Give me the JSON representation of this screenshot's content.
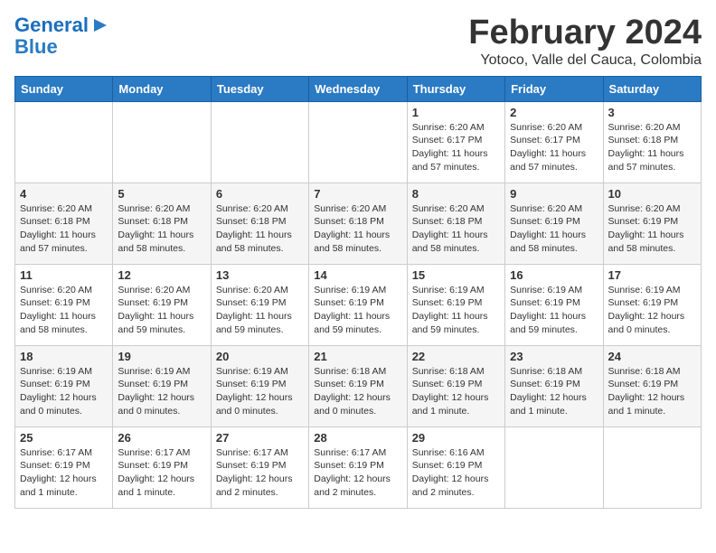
{
  "header": {
    "logo_line1": "General",
    "logo_line2": "Blue",
    "month": "February 2024",
    "location": "Yotoco, Valle del Cauca, Colombia"
  },
  "weekdays": [
    "Sunday",
    "Monday",
    "Tuesday",
    "Wednesday",
    "Thursday",
    "Friday",
    "Saturday"
  ],
  "weeks": [
    [
      {
        "day": "",
        "info": ""
      },
      {
        "day": "",
        "info": ""
      },
      {
        "day": "",
        "info": ""
      },
      {
        "day": "",
        "info": ""
      },
      {
        "day": "1",
        "info": "Sunrise: 6:20 AM\nSunset: 6:17 PM\nDaylight: 11 hours\nand 57 minutes."
      },
      {
        "day": "2",
        "info": "Sunrise: 6:20 AM\nSunset: 6:17 PM\nDaylight: 11 hours\nand 57 minutes."
      },
      {
        "day": "3",
        "info": "Sunrise: 6:20 AM\nSunset: 6:18 PM\nDaylight: 11 hours\nand 57 minutes."
      }
    ],
    [
      {
        "day": "4",
        "info": "Sunrise: 6:20 AM\nSunset: 6:18 PM\nDaylight: 11 hours\nand 57 minutes."
      },
      {
        "day": "5",
        "info": "Sunrise: 6:20 AM\nSunset: 6:18 PM\nDaylight: 11 hours\nand 58 minutes."
      },
      {
        "day": "6",
        "info": "Sunrise: 6:20 AM\nSunset: 6:18 PM\nDaylight: 11 hours\nand 58 minutes."
      },
      {
        "day": "7",
        "info": "Sunrise: 6:20 AM\nSunset: 6:18 PM\nDaylight: 11 hours\nand 58 minutes."
      },
      {
        "day": "8",
        "info": "Sunrise: 6:20 AM\nSunset: 6:18 PM\nDaylight: 11 hours\nand 58 minutes."
      },
      {
        "day": "9",
        "info": "Sunrise: 6:20 AM\nSunset: 6:19 PM\nDaylight: 11 hours\nand 58 minutes."
      },
      {
        "day": "10",
        "info": "Sunrise: 6:20 AM\nSunset: 6:19 PM\nDaylight: 11 hours\nand 58 minutes."
      }
    ],
    [
      {
        "day": "11",
        "info": "Sunrise: 6:20 AM\nSunset: 6:19 PM\nDaylight: 11 hours\nand 58 minutes."
      },
      {
        "day": "12",
        "info": "Sunrise: 6:20 AM\nSunset: 6:19 PM\nDaylight: 11 hours\nand 59 minutes."
      },
      {
        "day": "13",
        "info": "Sunrise: 6:20 AM\nSunset: 6:19 PM\nDaylight: 11 hours\nand 59 minutes."
      },
      {
        "day": "14",
        "info": "Sunrise: 6:19 AM\nSunset: 6:19 PM\nDaylight: 11 hours\nand 59 minutes."
      },
      {
        "day": "15",
        "info": "Sunrise: 6:19 AM\nSunset: 6:19 PM\nDaylight: 11 hours\nand 59 minutes."
      },
      {
        "day": "16",
        "info": "Sunrise: 6:19 AM\nSunset: 6:19 PM\nDaylight: 11 hours\nand 59 minutes."
      },
      {
        "day": "17",
        "info": "Sunrise: 6:19 AM\nSunset: 6:19 PM\nDaylight: 12 hours\nand 0 minutes."
      }
    ],
    [
      {
        "day": "18",
        "info": "Sunrise: 6:19 AM\nSunset: 6:19 PM\nDaylight: 12 hours\nand 0 minutes."
      },
      {
        "day": "19",
        "info": "Sunrise: 6:19 AM\nSunset: 6:19 PM\nDaylight: 12 hours\nand 0 minutes."
      },
      {
        "day": "20",
        "info": "Sunrise: 6:19 AM\nSunset: 6:19 PM\nDaylight: 12 hours\nand 0 minutes."
      },
      {
        "day": "21",
        "info": "Sunrise: 6:18 AM\nSunset: 6:19 PM\nDaylight: 12 hours\nand 0 minutes."
      },
      {
        "day": "22",
        "info": "Sunrise: 6:18 AM\nSunset: 6:19 PM\nDaylight: 12 hours\nand 1 minute."
      },
      {
        "day": "23",
        "info": "Sunrise: 6:18 AM\nSunset: 6:19 PM\nDaylight: 12 hours\nand 1 minute."
      },
      {
        "day": "24",
        "info": "Sunrise: 6:18 AM\nSunset: 6:19 PM\nDaylight: 12 hours\nand 1 minute."
      }
    ],
    [
      {
        "day": "25",
        "info": "Sunrise: 6:17 AM\nSunset: 6:19 PM\nDaylight: 12 hours\nand 1 minute."
      },
      {
        "day": "26",
        "info": "Sunrise: 6:17 AM\nSunset: 6:19 PM\nDaylight: 12 hours\nand 1 minute."
      },
      {
        "day": "27",
        "info": "Sunrise: 6:17 AM\nSunset: 6:19 PM\nDaylight: 12 hours\nand 2 minutes."
      },
      {
        "day": "28",
        "info": "Sunrise: 6:17 AM\nSunset: 6:19 PM\nDaylight: 12 hours\nand 2 minutes."
      },
      {
        "day": "29",
        "info": "Sunrise: 6:16 AM\nSunset: 6:19 PM\nDaylight: 12 hours\nand 2 minutes."
      },
      {
        "day": "",
        "info": ""
      },
      {
        "day": "",
        "info": ""
      }
    ]
  ]
}
